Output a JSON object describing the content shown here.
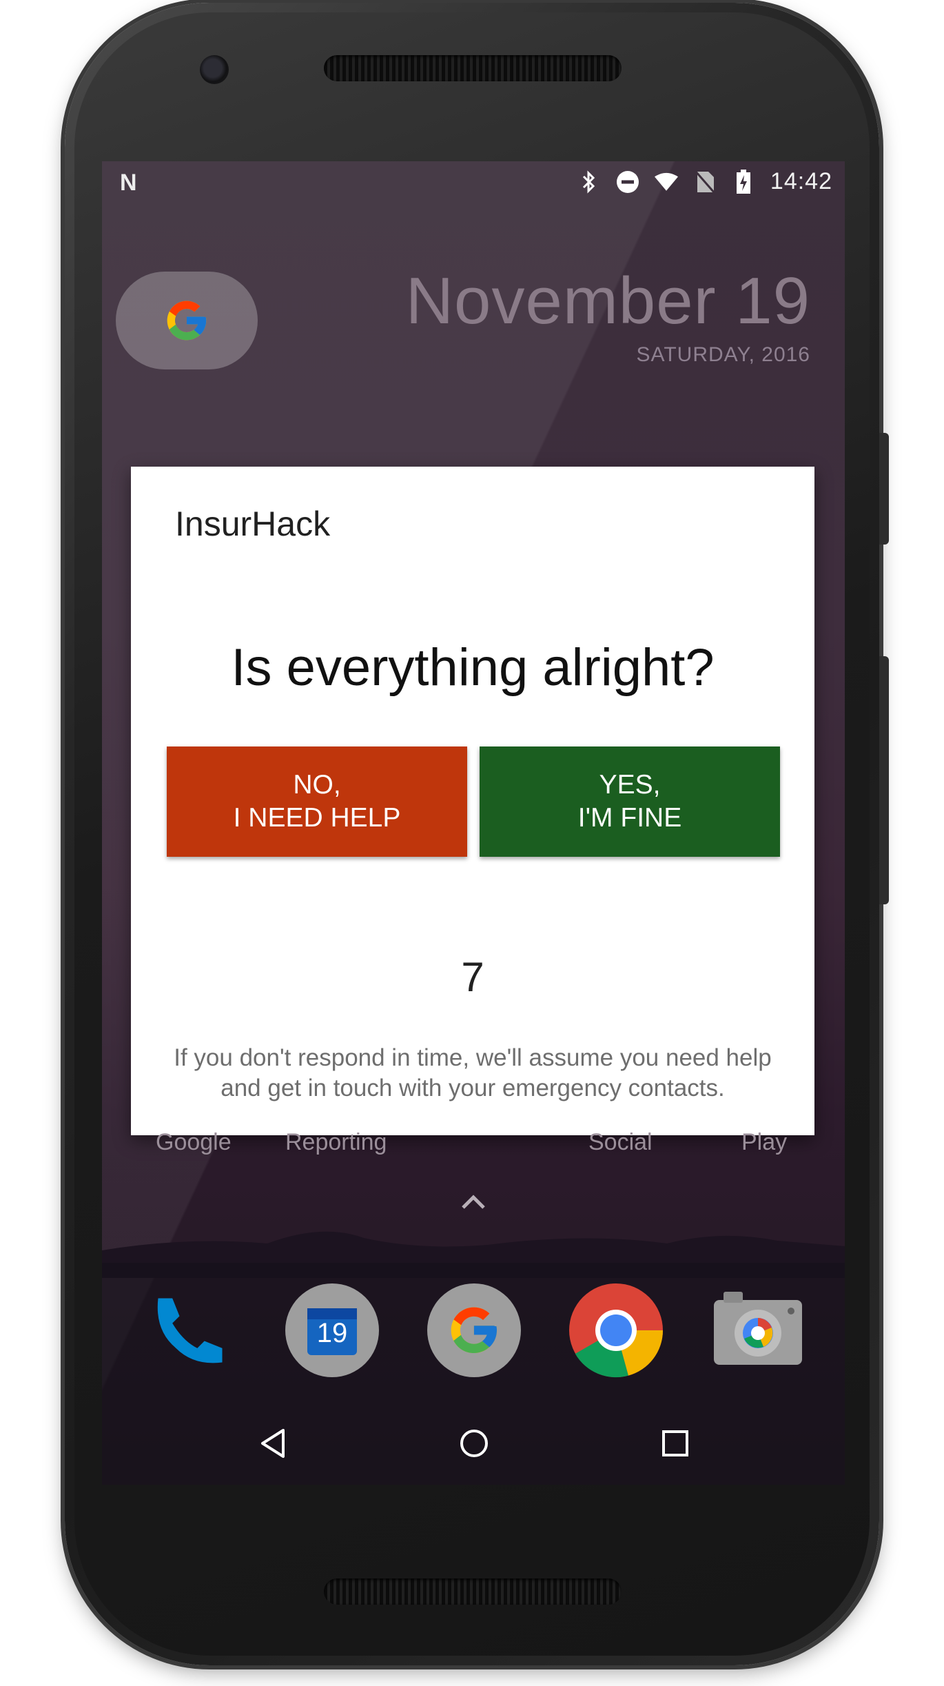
{
  "status_bar": {
    "notification_icon": "N",
    "time": "14:42",
    "icons": [
      "bluetooth-icon",
      "do-not-disturb-icon",
      "wifi-icon",
      "no-sim-icon",
      "battery-charging-icon"
    ]
  },
  "home": {
    "date_title": "November 19",
    "date_subtitle": "SATURDAY, 2016",
    "dock_labels": {
      "google": "Google",
      "reporting": "Reporting",
      "social": "Social",
      "play": "Play"
    },
    "calendar_day": "19"
  },
  "dialog": {
    "app_name": "InsurHack",
    "question": "Is everything alright?",
    "no_button_line1": "NO,",
    "no_button_line2": "I NEED HELP",
    "yes_button_line1": "YES,",
    "yes_button_line2": "I'M FINE",
    "countdown": "7",
    "note_line1": "If you don't respond in time, we'll assume you need help",
    "note_line2": "and get in touch with your emergency contacts."
  },
  "colors": {
    "no_button": "#bf360c",
    "yes_button": "#1b5e20",
    "dialog_bg": "#ffffff"
  },
  "navigation": [
    "back-icon",
    "home-icon",
    "recents-icon"
  ]
}
